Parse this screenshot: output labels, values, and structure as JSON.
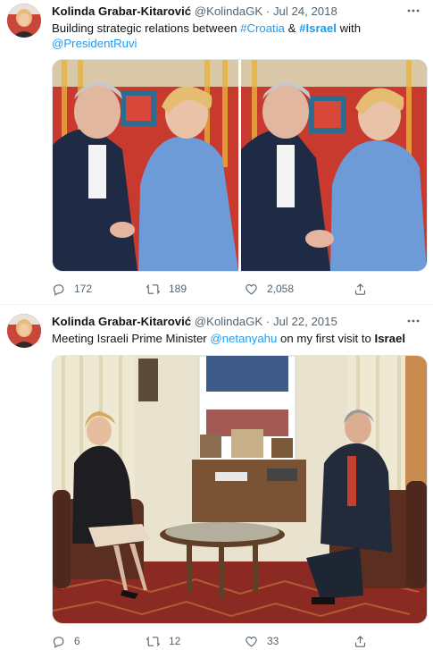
{
  "tweets": [
    {
      "name": "Kolinda Grabar-Kitarović",
      "handle": "@KolindaGK",
      "dot": "·",
      "date": "Jul 24, 2018",
      "text_parts": [
        "Building strategic relations between ",
        "#Croatia",
        " & ",
        "#Israel",
        " with",
        "@PresidentRuvi"
      ],
      "replies": "172",
      "retweets": "189",
      "likes": "2,058"
    },
    {
      "name": "Kolinda Grabar-Kitarović",
      "handle": "@KolindaGK",
      "dot": "·",
      "date": "Jul 22, 2015",
      "text_parts": [
        "Meeting Israeli Prime Minister ",
        "@netanyahu",
        " on my first visit to ",
        "Israel"
      ],
      "replies": "6",
      "retweets": "12",
      "likes": "33"
    }
  ],
  "icons": {
    "more": "more-dots-icon",
    "reply": "reply-icon",
    "retweet": "retweet-icon",
    "like": "heart-icon",
    "share": "share-icon"
  },
  "colors": {
    "link": "#1d9bf0",
    "text": "#0f1419",
    "secondary": "#536471"
  }
}
